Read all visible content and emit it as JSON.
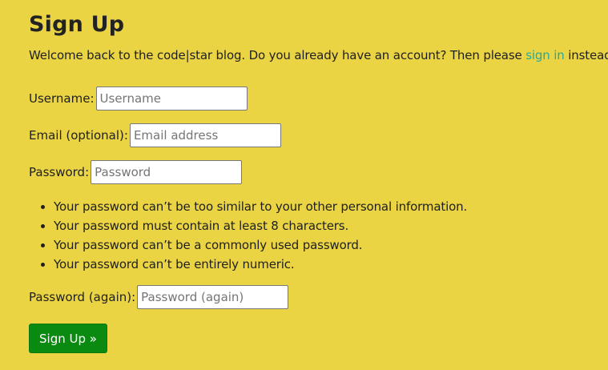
{
  "page": {
    "title": "Sign Up",
    "intro_prefix": "Welcome back to the code|star blog. Do you already have an account? Then please ",
    "intro_link": "sign in",
    "intro_suffix": " instead."
  },
  "form": {
    "username_label": "Username:",
    "username_placeholder": "Username",
    "email_label": "Email (optional):",
    "email_placeholder": "Email address",
    "password_label": "Password:",
    "password_placeholder": "Password",
    "password_rules": [
      "Your password can’t be too similar to your other personal information.",
      "Your password must contain at least 8 characters.",
      "Your password can’t be a commonly used password.",
      "Your password can’t be entirely numeric."
    ],
    "password2_label": "Password (again):",
    "password2_placeholder": "Password (again)",
    "submit_label": "Sign Up »"
  },
  "colors": {
    "background": "#ead444",
    "link": "#2aa89c",
    "submit": "#0a8a10"
  }
}
